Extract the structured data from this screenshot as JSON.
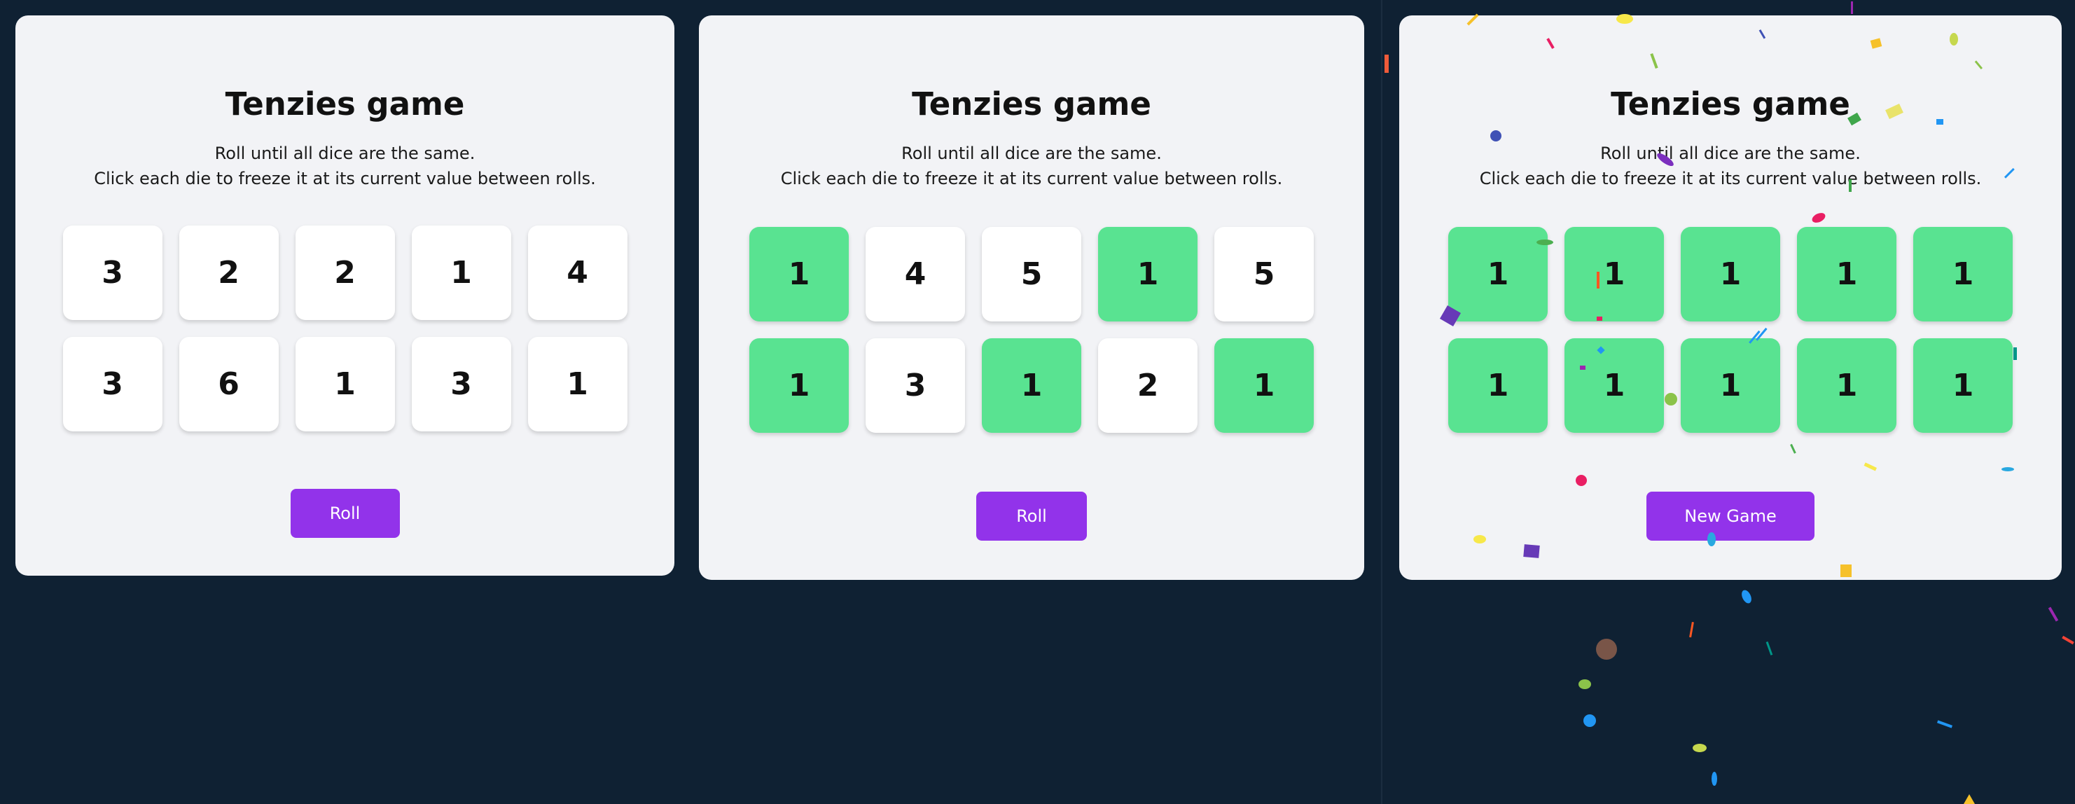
{
  "colors": {
    "background": "#0f2133",
    "panel": "#f2f3f6",
    "die": "#ffffff",
    "held_die": "#59e391",
    "button": "#9233ea",
    "button_text": "#ffffff"
  },
  "panels": [
    {
      "title": "Tenzies game",
      "instructions_line1": "Roll until all dice are the same.",
      "instructions_line2": "Click each die to freeze it at its current value between rolls.",
      "dice": [
        {
          "value": "3",
          "held": false
        },
        {
          "value": "2",
          "held": false
        },
        {
          "value": "2",
          "held": false
        },
        {
          "value": "1",
          "held": false
        },
        {
          "value": "4",
          "held": false
        },
        {
          "value": "3",
          "held": false
        },
        {
          "value": "6",
          "held": false
        },
        {
          "value": "1",
          "held": false
        },
        {
          "value": "3",
          "held": false
        },
        {
          "value": "1",
          "held": false
        }
      ],
      "button_label": "Roll"
    },
    {
      "title": "Tenzies game",
      "instructions_line1": "Roll until all dice are the same.",
      "instructions_line2": "Click each die to freeze it at its current value between rolls.",
      "dice": [
        {
          "value": "1",
          "held": true
        },
        {
          "value": "4",
          "held": false
        },
        {
          "value": "5",
          "held": false
        },
        {
          "value": "1",
          "held": true
        },
        {
          "value": "5",
          "held": false
        },
        {
          "value": "1",
          "held": true
        },
        {
          "value": "3",
          "held": false
        },
        {
          "value": "1",
          "held": true
        },
        {
          "value": "2",
          "held": false
        },
        {
          "value": "1",
          "held": true
        }
      ],
      "button_label": "Roll"
    },
    {
      "title": "Tenzies game",
      "instructions_line1": "Roll until all dice are the same.",
      "instructions_line2": "Click each die to freeze it at its current value between rolls.",
      "dice": [
        {
          "value": "1",
          "held": true
        },
        {
          "value": "1",
          "held": true
        },
        {
          "value": "1",
          "held": true
        },
        {
          "value": "1",
          "held": true
        },
        {
          "value": "1",
          "held": true
        },
        {
          "value": "1",
          "held": true
        },
        {
          "value": "1",
          "held": true
        },
        {
          "value": "1",
          "held": true
        },
        {
          "value": "1",
          "held": true
        },
        {
          "value": "1",
          "held": true
        }
      ],
      "button_label": "New Game"
    }
  ]
}
